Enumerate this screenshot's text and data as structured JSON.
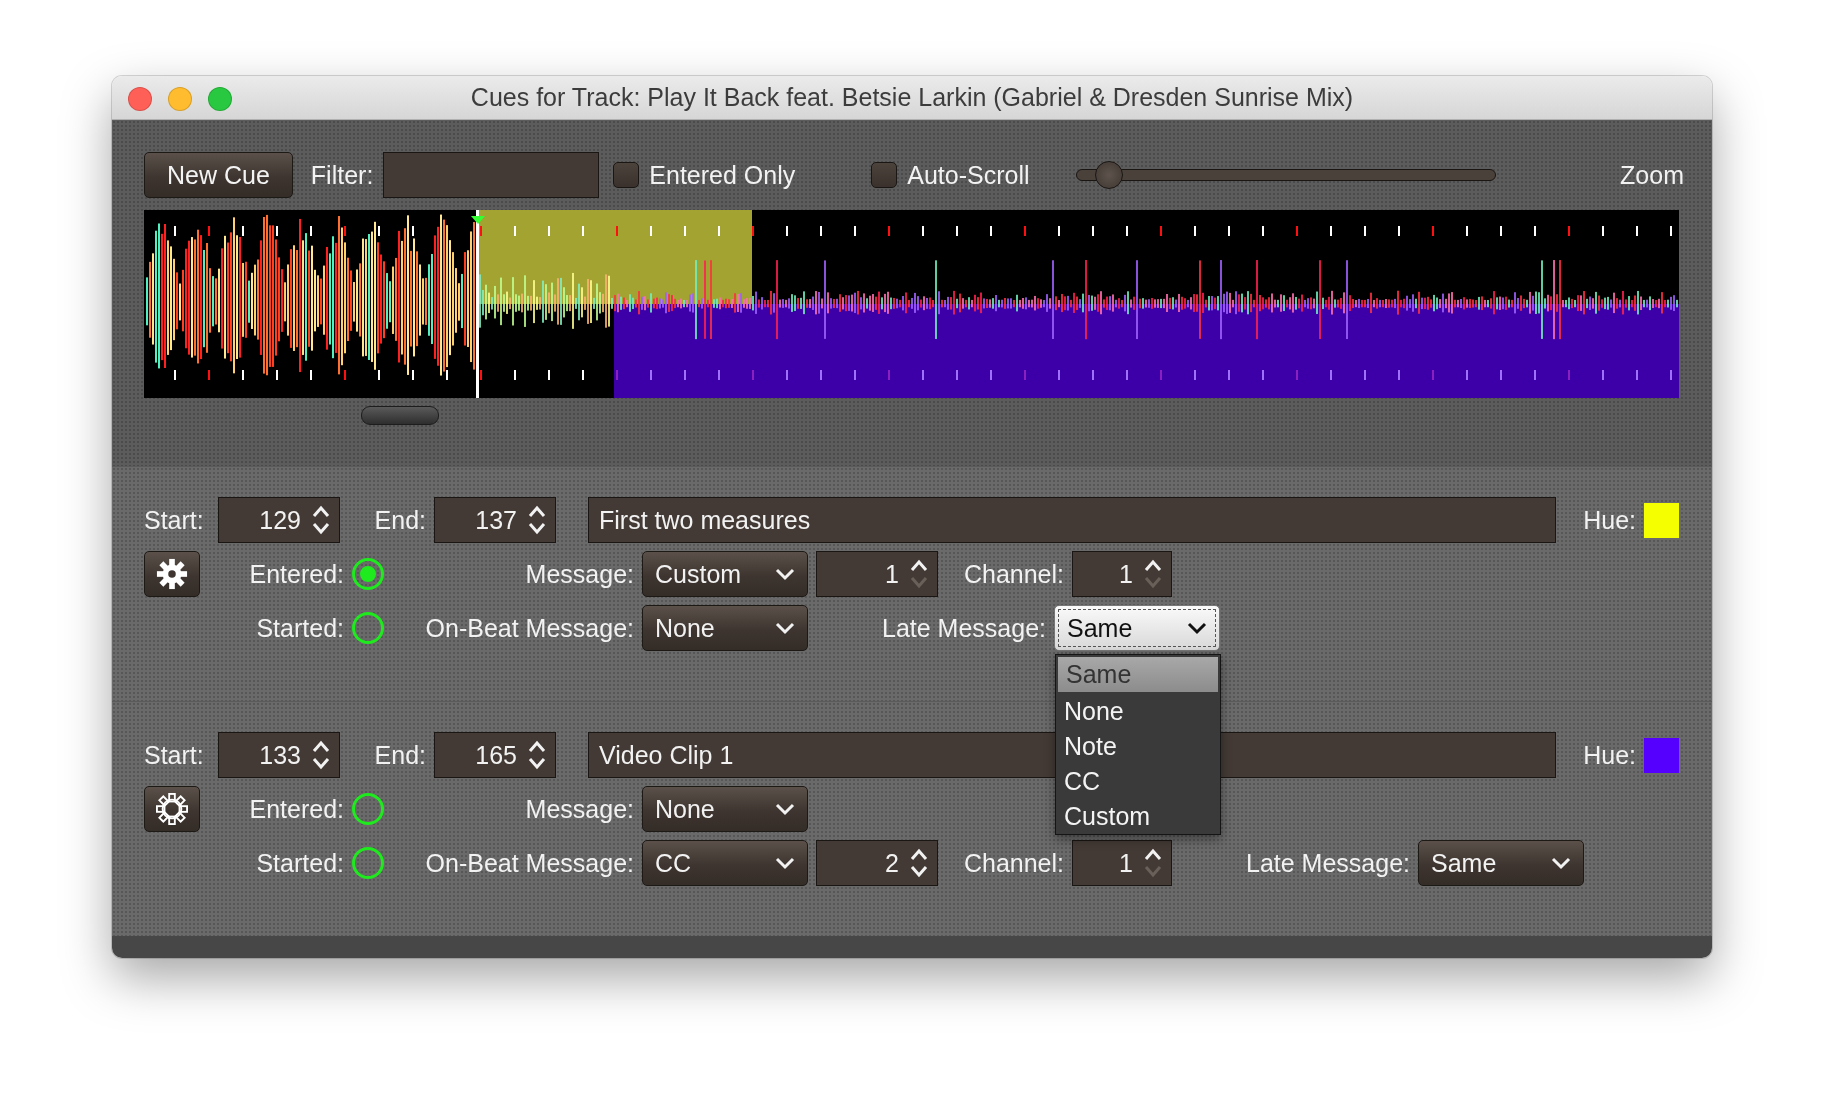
{
  "window": {
    "title": "Cues for Track: Play It Back feat. Betsie Larkin (Gabriel & Dresden Sunrise Mix)"
  },
  "toolbar": {
    "new_cue_button": "New Cue",
    "filter": {
      "label": "Filter:"
    },
    "entered_only": {
      "label": "Entered Only",
      "checked": false
    },
    "auto_scroll": {
      "label": "Auto-Scroll",
      "checked": false
    },
    "zoom": {
      "label": "Zoom",
      "level": 0.08
    }
  },
  "cues": [
    {
      "start": {
        "label": "Start:",
        "value": "129"
      },
      "end": {
        "label": "End:",
        "value": "137"
      },
      "name": "First two measures",
      "hue": {
        "label": "Hue:",
        "color": "#f5ff00"
      },
      "settings_filled": true,
      "entered": {
        "label": "Entered:",
        "on": true
      },
      "started": {
        "label": "Started:",
        "on": false
      },
      "message": {
        "label": "Message:",
        "value": "Custom",
        "number": {
          "value": "1",
          "down_disabled": true
        },
        "channel": {
          "label": "Channel:",
          "value": "1",
          "down_disabled": true
        }
      },
      "on_beat_message": {
        "label": "On-Beat Message:",
        "value": "None"
      },
      "late_message": {
        "label": "Late Message:",
        "value": "Same",
        "open": true,
        "options": [
          {
            "label": "Same",
            "selected": true
          },
          {
            "label": "None",
            "selected": false
          },
          {
            "label": "Note",
            "selected": false
          },
          {
            "label": "CC",
            "selected": false
          },
          {
            "label": "Custom",
            "selected": false
          }
        ]
      }
    },
    {
      "start": {
        "label": "Start:",
        "value": "133"
      },
      "end": {
        "label": "End:",
        "value": "165"
      },
      "name": "Video Clip 1",
      "hue": {
        "label": "Hue:",
        "color": "#5500ff"
      },
      "settings_filled": false,
      "entered": {
        "label": "Entered:",
        "on": false
      },
      "started": {
        "label": "Started:",
        "on": false
      },
      "message": {
        "label": "Message:",
        "value": "None"
      },
      "on_beat_message": {
        "label": "On-Beat Message:",
        "value": "CC",
        "number": {
          "value": "2",
          "down_disabled": false
        },
        "channel": {
          "label": "Channel:",
          "value": "1",
          "down_disabled": true
        }
      },
      "late_message": {
        "label": "Late Message:",
        "value": "Same",
        "open": false
      }
    }
  ]
}
